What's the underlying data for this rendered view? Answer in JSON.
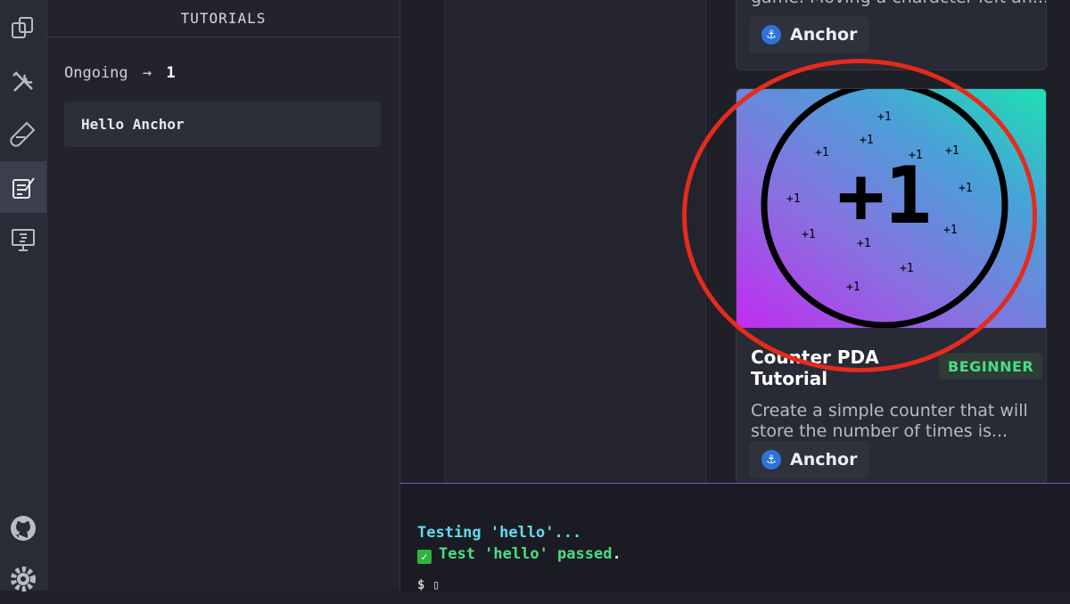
{
  "sidebar_header": "TUTORIALS",
  "ongoing": {
    "label": "Ongoing",
    "arrow": "→",
    "count": "1"
  },
  "tutorials": [
    {
      "title": "Hello Anchor"
    }
  ],
  "top_card": {
    "desc_partial": "game. Moving a character left an...",
    "framework": "Anchor"
  },
  "card": {
    "title": "Counter PDA Tutorial",
    "level": "BEGINNER",
    "description": "Create a simple counter that will store the number of times is...",
    "framework": "Anchor",
    "image_big_text": "+1",
    "image_small_text": "+1"
  },
  "terminal": {
    "line1": "Testing 'hello'...",
    "line2_check": "✓",
    "line2": "Test 'hello' passed",
    "line2_end": ".",
    "prompt": "$ ▯"
  },
  "colors": {
    "highlight": "#e42b1d",
    "beginner": "#4ade80",
    "terminal_cyan": "#67d8ef",
    "accent_line": "#7c5cc4"
  },
  "icons": [
    "explorer-icon",
    "build-icon",
    "test-icon",
    "tutorials-icon",
    "playground-icon",
    "github-icon",
    "settings-icon",
    "anchor-icon",
    "check-icon"
  ]
}
